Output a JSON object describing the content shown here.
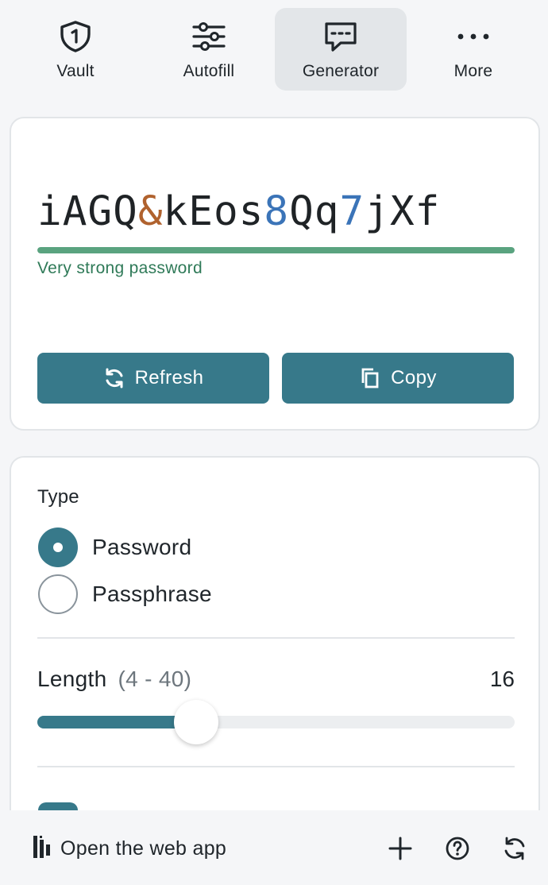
{
  "nav": {
    "tabs": [
      {
        "label": "Vault",
        "icon": "shield-icon"
      },
      {
        "label": "Autofill",
        "icon": "sliders-icon"
      },
      {
        "label": "Generator",
        "icon": "chat-password-icon",
        "active": true
      },
      {
        "label": "More",
        "icon": "more-icon"
      }
    ]
  },
  "generator": {
    "password": [
      "iAGQ",
      "&",
      "kEos",
      "8",
      "Qq",
      "7",
      "jXf"
    ],
    "strength_label": "Very strong password",
    "strength_level": 1.0,
    "refresh_label": "Refresh",
    "copy_label": "Copy"
  },
  "options": {
    "type_label": "Type",
    "types": [
      {
        "label": "Password",
        "checked": true
      },
      {
        "label": "Passphrase",
        "checked": false
      }
    ],
    "length_label": "Length",
    "length_range": "(4 - 40)",
    "length_value": "16",
    "length_min": 4,
    "length_max": 40,
    "length_current": 16
  },
  "footer": {
    "open_web_label": "Open the web app",
    "icons": [
      "plus-icon",
      "help-icon",
      "sync-icon"
    ]
  },
  "colors": {
    "accent": "#37798a",
    "strength": "#5aa37f",
    "symbol": "#b0622e",
    "number": "#3b74b8"
  }
}
